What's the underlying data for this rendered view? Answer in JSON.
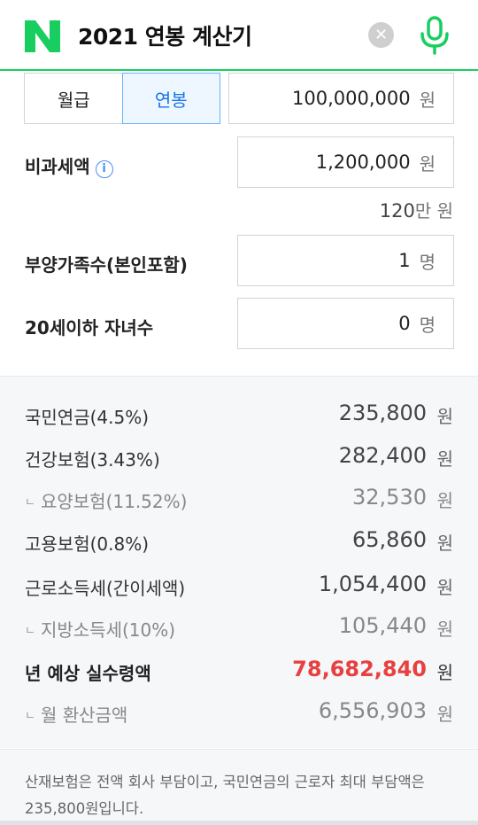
{
  "header": {
    "title": "2021 연봉 계산기",
    "logo_letter": "N",
    "brand_color": "#19ce60"
  },
  "tabs": [
    {
      "label": "월급",
      "active": false
    },
    {
      "label": "연봉",
      "active": true
    }
  ],
  "salary": {
    "value": "100,000,000",
    "unit": "원"
  },
  "nontax": {
    "label": "비과세액",
    "value": "1,200,000",
    "unit": "원",
    "hint_value": "120",
    "hint_unit": "만 원"
  },
  "dependents": {
    "label": "부양가족수(본인포함)",
    "value": "1",
    "unit": "명"
  },
  "children": {
    "label": "20세이하 자녀수",
    "value": "0",
    "unit": "명"
  },
  "results": [
    {
      "label": "국민연금(4.5%)",
      "value": "235,800",
      "unit": "원"
    },
    {
      "label": "건강보험(3.43%)",
      "value": "282,400",
      "unit": "원"
    },
    {
      "label": "요양보험(11.52%)",
      "value": "32,530",
      "unit": "원",
      "sub": true
    },
    {
      "label": "고용보험(0.8%)",
      "value": "65,860",
      "unit": "원"
    },
    {
      "label": "근로소득세(간이세액)",
      "value": "1,054,400",
      "unit": "원"
    },
    {
      "label": "지방소득세(10%)",
      "value": "105,440",
      "unit": "원",
      "sub": true
    },
    {
      "label": "년 예상 실수령액",
      "value": "78,682,840",
      "unit": "원",
      "main": true
    },
    {
      "label": "월 환산금액",
      "value": "6,556,903",
      "unit": "원",
      "sub": true
    }
  ],
  "sub_marker": "ㄴ",
  "notice": "산재보험은 전액 회사 부담이고, 국민연금의 근로자 최대 부담액은 235,800원입니다.",
  "colors": {
    "accent": "#1a73e8",
    "highlight": "#e84040"
  }
}
